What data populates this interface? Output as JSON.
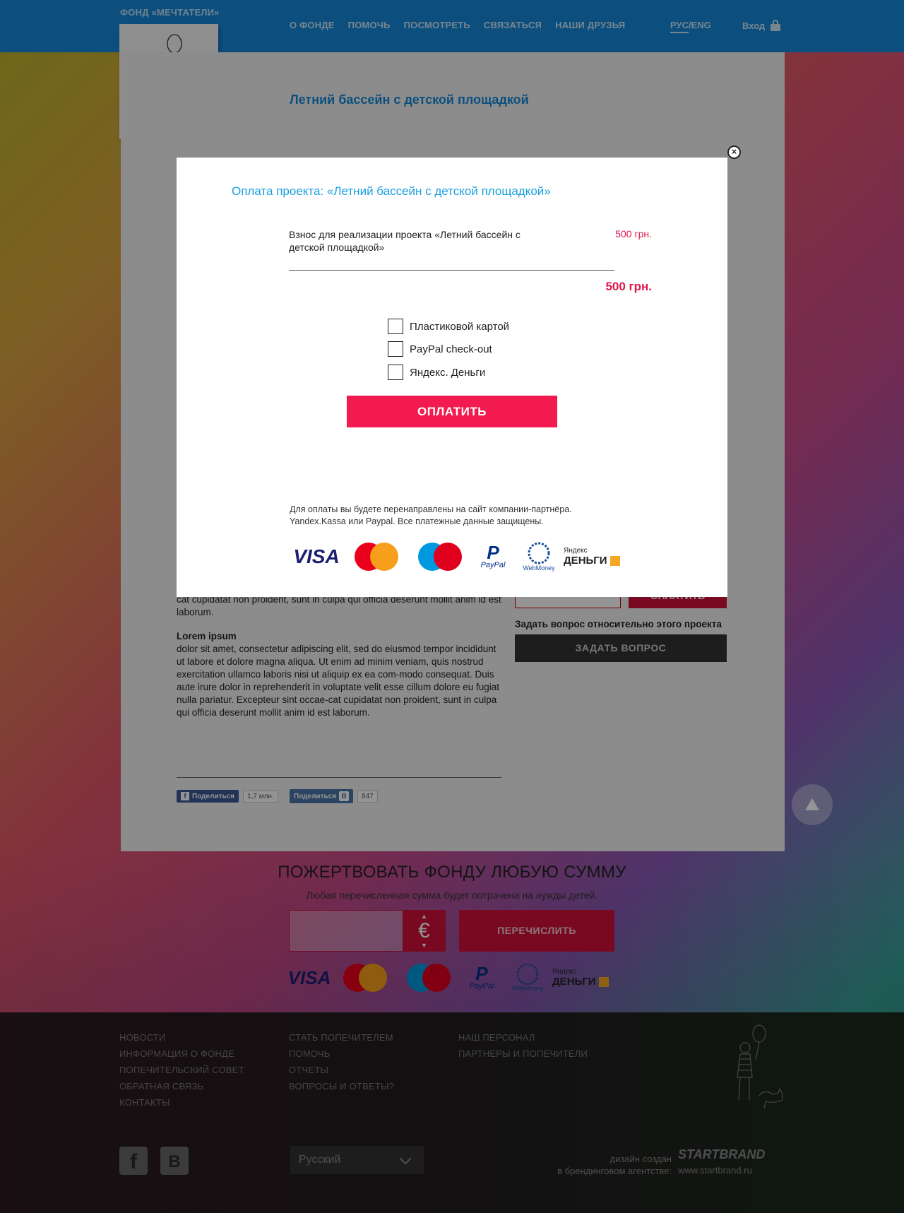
{
  "header": {
    "fund_name": "ФОНД «МЕЧТАТЕЛИ»",
    "nav": [
      "О ФОНДЕ",
      "ПОМОЧЬ",
      "ПОСМОТРЕТЬ",
      "СВЯЗАТЬСЯ",
      "НАШИ ДРУЗЬЯ"
    ],
    "lang_active": "РУС",
    "lang_sep": "/",
    "lang_other": "ENG",
    "login": "Вход"
  },
  "page": {
    "title": "Летний бассейн с детской площадкой"
  },
  "article": {
    "para1": "cat cupidatat non proident, sunt in culpa qui officia deserunt mollit anim id est laborum.",
    "heading2": "Lorem ipsum",
    "para2": "dolor sit amet, consectetur adipiscing elit, sed do eiusmod tempor incididunt ut labore et dolore magna aliqua. Ut enim ad minim veniam, quis nostrud exercitation ullamco laboris nisi ut aliquip ex ea com-modo consequat. Duis aute irure dolor in reprehenderit in voluptate velit esse cillum dolore eu fugiat nulla pariatur. Excepteur sint occae-cat cupidatat non proident, sunt in culpa qui officia deserunt mollit anim id est laborum."
  },
  "share": {
    "fb_label": "Поделиться",
    "fb_count": "1,7 млн.",
    "vk_label": "Поделиться",
    "vk_count": "847"
  },
  "sidebar": {
    "pay_label": "ОПЛАТИТЬ",
    "ask_label": "Задать вопрос относительно этого проекта",
    "ask_button": "ЗАДАТЬ ВОПРОС"
  },
  "donate": {
    "title": "ПОЖЕРТВОВАТЬ ФОНДУ ЛЮБУЮ СУММУ",
    "subtitle": "Любая перечисленная сумма будет потрачена на нужды детей.",
    "currency": "€",
    "button": "ПЕРЕЧИСЛИТЬ"
  },
  "payment_logos": {
    "visa": "VISA",
    "mastercard": "MasterCard",
    "maestro": "Maestro",
    "paypal": "PayPal",
    "webmoney": "WebMoney",
    "yandex_top": "Яндекс",
    "yandex_bottom": "ДЕНЬГИ"
  },
  "footer": {
    "col1": [
      "НОВОСТИ",
      "ИНФОРМАЦИЯ О ФОНДЕ",
      "ПОПЕЧИТЕЛЬСКИЙ СОВЕТ",
      "ОБРАТНАЯ СВЯЗЬ",
      "КОНТАКТЫ"
    ],
    "col2": [
      "СТАТЬ ПОПЕЧИТЕЛЕМ",
      "ПОМОЧЬ",
      "ОТЧЕТЫ",
      "ВОПРОСЫ И ОТВЕТЫ?"
    ],
    "col3": [
      "НАШ ПЕРСОНАЛ",
      "ПАРТНЕРЫ И ПОПЕЧИТЕЛИ"
    ],
    "language": "Русский",
    "credit_line1": "дизайн создан",
    "credit_line2": "в брендинговом агентстве:",
    "agency": "STARTBRAND",
    "agency_url": "www.startbrand.ru"
  },
  "modal": {
    "title": "Оплата проекта: «Летний бассейн с детской площадкой»",
    "fee_label": "Взнос для реализации проекта «Летний бассейн с детской площадкой»",
    "fee_value": "500 грн.",
    "total": "500 грн.",
    "options": [
      "Пластиковой картой",
      "PayPal check-out",
      "Яндекс. Деньги"
    ],
    "pay_button": "ОПЛАТИТЬ",
    "note": "Для оплаты вы будете перенаправлены на сайт компании-партнёра. Yandex.Kassa или Paypal. Все платежные данные защищены.",
    "close": "×"
  },
  "colors": {
    "header_blue": "#1689d9",
    "accent_red": "#f21a4e",
    "title_blue": "#1a9fe0"
  }
}
